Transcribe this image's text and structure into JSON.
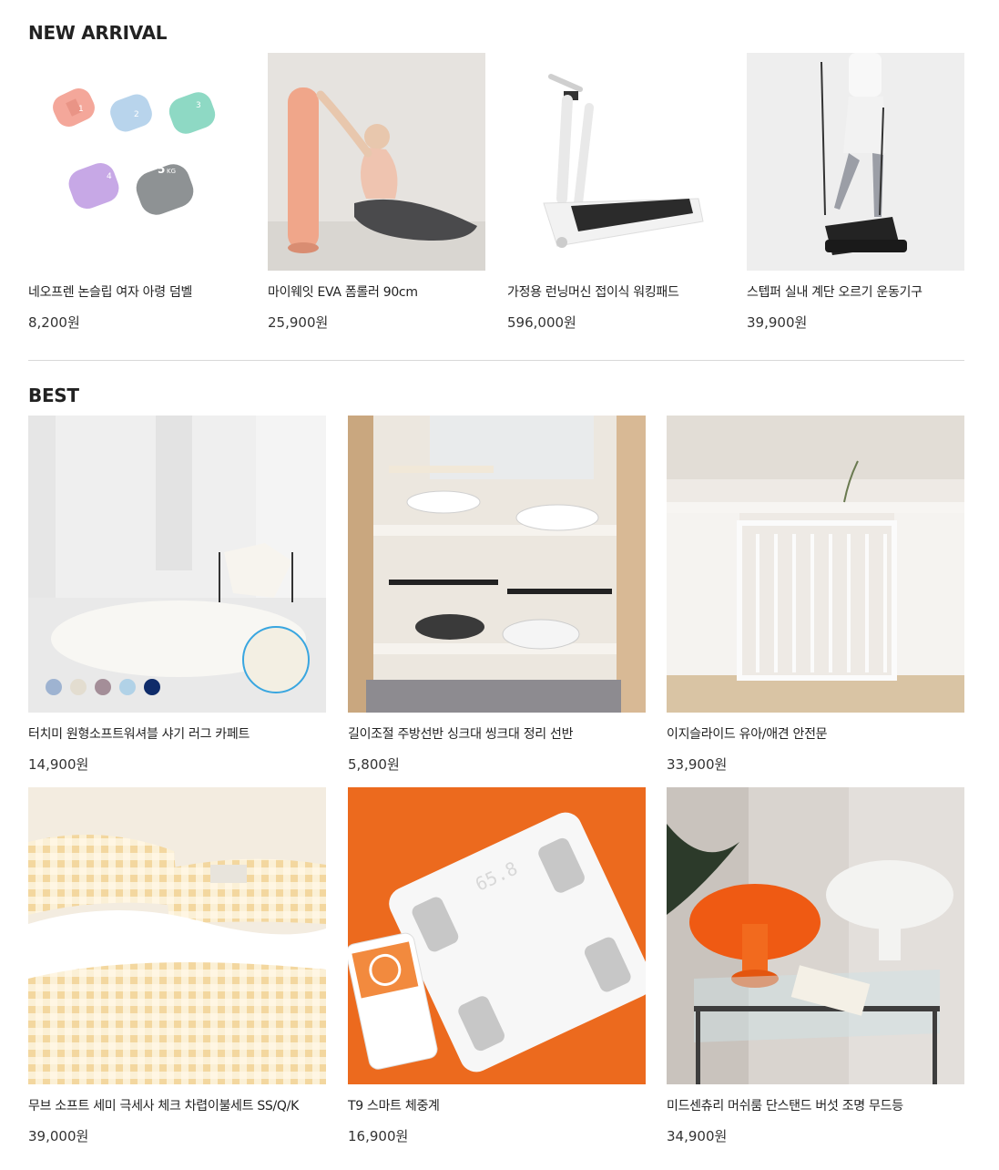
{
  "new_arrival": {
    "title": "NEW ARRIVAL",
    "items": [
      {
        "name": "네오프렌 논슬립 여자 아령 덤벨",
        "price": "8,200원"
      },
      {
        "name": "마이웨잇 EVA 폼롤러 90cm",
        "price": "25,900원"
      },
      {
        "name": "가정용 런닝머신 접이식 워킹패드",
        "price": "596,000원"
      },
      {
        "name": "스텝퍼 실내 계단 오르기 운동기구",
        "price": "39,900원"
      }
    ]
  },
  "best": {
    "title": "BEST",
    "items": [
      {
        "name": "터치미 원형소프트워셔블 샤기 러그 카페트",
        "price": "14,900원"
      },
      {
        "name": "길이조절 주방선반 싱크대 씽크대 정리 선반",
        "price": "5,800원"
      },
      {
        "name": "이지슬라이드 유아/애견 안전문",
        "price": "33,900원"
      },
      {
        "name": "무브 소프트 세미 극세사 체크 차렵이불세트 SS/Q/K",
        "price": "39,000원"
      },
      {
        "name": "T9 스마트 체중계",
        "price": "16,900원"
      },
      {
        "name": "미드센츄리 머쉬룸 단스탠드 버섯 조명 무드등",
        "price": "34,900원"
      }
    ]
  },
  "image_texts": {
    "dumbbell_weights": [
      "1",
      "2",
      "3",
      "4",
      "5"
    ],
    "dumbbell_unit": "KG",
    "scale_display": "65.8"
  }
}
